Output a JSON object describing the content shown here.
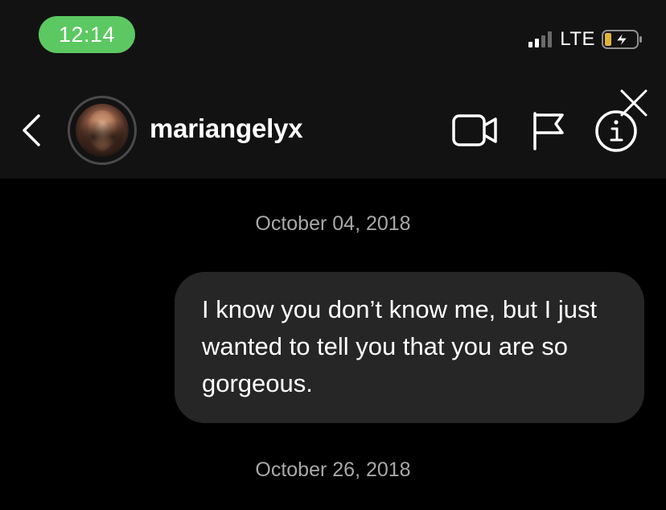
{
  "status_bar": {
    "time": "12:14",
    "network": "LTE",
    "signal_bars_filled": 2,
    "signal_bars_total": 4,
    "time_pill_color": "#5cc861"
  },
  "header": {
    "back_icon": "chevron-left-icon",
    "username": "mariangelyx",
    "actions": {
      "video_icon": "video-camera-icon",
      "flag_icon": "flag-icon",
      "info_icon": "info-icon",
      "close_icon": "close-icon"
    }
  },
  "conversation": {
    "date_1": "October 04, 2018",
    "message_1": "I know you don’t know me, but I just wanted to tell you that you are so gorgeous.",
    "date_2": "October 26, 2018"
  },
  "colors": {
    "background": "#000000",
    "header_background": "#121212",
    "bubble_background": "#262626",
    "date_text": "#a8a8a8"
  }
}
